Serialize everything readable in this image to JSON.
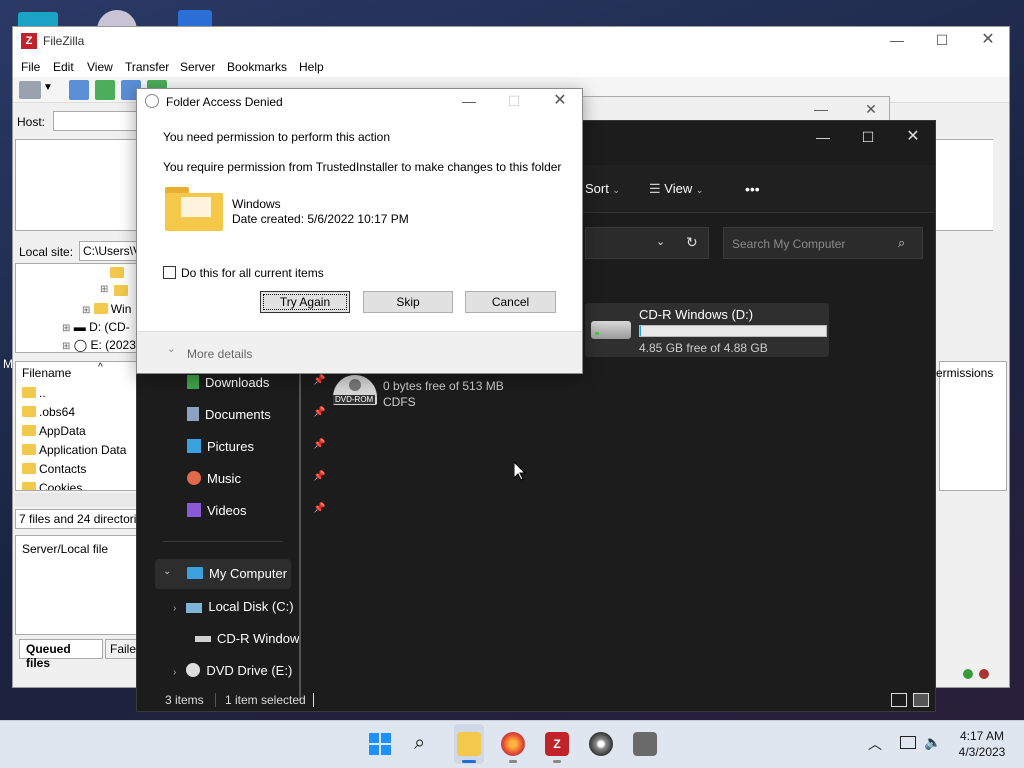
{
  "filezilla": {
    "title": "FileZilla",
    "menu": [
      "File",
      "Edit",
      "View",
      "Transfer",
      "Server",
      "Bookmarks",
      "Help"
    ],
    "host_label": "Host:",
    "local_site_label": "Local site:",
    "local_site_value": "C:\\Users\\V",
    "tree": [
      {
        "label": "Win"
      },
      {
        "label": "D: (CD-"
      },
      {
        "label": "E: (2023"
      }
    ],
    "filename_header": "Filename",
    "files": [
      "..",
      ".obs64",
      "AppData",
      "Application Data",
      "Contacts",
      "Cookies"
    ],
    "status_local": "7 files and 24 directorie",
    "queue_header": "Server/Local file",
    "tabs": [
      "Queued files",
      "Faile"
    ],
    "remote_header_fragment": "ermissions",
    "fragment_m": "M"
  },
  "dialog": {
    "title": "Folder Access Denied",
    "heading": "You need permission to perform this action",
    "message": "You require permission from TrustedInstaller to make changes to this folder",
    "item_name": "Windows",
    "item_date": "Date created: 5/6/2022 10:17 PM",
    "checkbox_label": "Do this for all current items",
    "try_again": "Try Again",
    "skip": "Skip",
    "cancel": "Cancel",
    "more_details": "More details"
  },
  "explorer": {
    "toolbar": {
      "sort": "Sort",
      "view": "View",
      "more": "•••"
    },
    "search_placeholder": "Search My Computer",
    "drive_d": {
      "name": "CD-R Windows (D:)",
      "free": "4.85 GB free of 4.88 GB",
      "used_fraction": 0.006
    },
    "drive_e": {
      "label_icon": "DVD-ROM",
      "free": "0 bytes free of 513 MB",
      "fs": "CDFS"
    },
    "quick_access": [
      {
        "label": "Downloads",
        "icon": "download-icon",
        "color": "#3fa34d"
      },
      {
        "label": "Documents",
        "icon": "document-icon",
        "color": "#8da2c0"
      },
      {
        "label": "Pictures",
        "icon": "picture-icon",
        "color": "#3aa0e0"
      },
      {
        "label": "Music",
        "icon": "music-icon",
        "color": "#e06a4a"
      },
      {
        "label": "Videos",
        "icon": "video-icon",
        "color": "#8a5ad8"
      }
    ],
    "tree": [
      {
        "label": "My Computer"
      },
      {
        "label": "Local Disk (C:)"
      },
      {
        "label": "CD-R Window"
      },
      {
        "label": "DVD Drive (E:)"
      }
    ],
    "status_items": "3 items",
    "status_selected": "1 item selected"
  },
  "taskbar": {
    "time": "4:17 AM",
    "date": "4/3/2023"
  }
}
